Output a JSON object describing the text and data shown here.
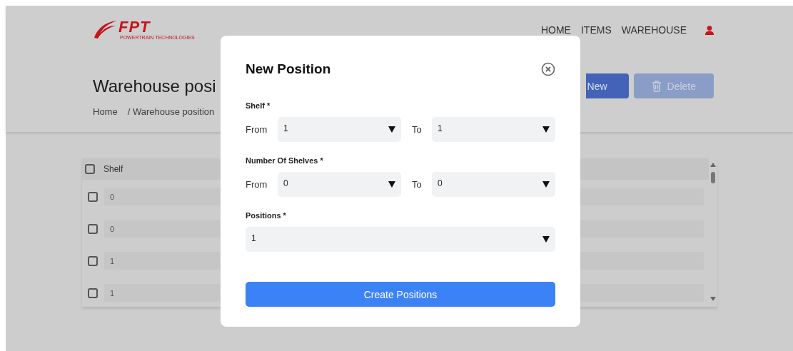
{
  "header": {
    "logo": {
      "brand": "FPT",
      "tagline": "POWERTRAIN TECHNOLOGIES"
    },
    "nav": [
      {
        "label": "HOME"
      },
      {
        "label": "ITEMS"
      },
      {
        "label": "WAREHOUSE"
      }
    ]
  },
  "page": {
    "title": "Warehouse posi",
    "breadcrumb": [
      {
        "label": "Home"
      },
      {
        "label": "/ Warehouse position"
      }
    ],
    "actions": [
      {
        "label": "New",
        "kind": "primary",
        "disabled": false
      },
      {
        "label": "Delete",
        "kind": "delete",
        "disabled": true
      }
    ]
  },
  "table": {
    "header": {
      "label": "Shelf",
      "checked": false
    },
    "rows": [
      {
        "shelf": "0",
        "checked": false
      },
      {
        "shelf": "0",
        "checked": false
      },
      {
        "shelf": "1",
        "checked": false
      },
      {
        "shelf": "1",
        "checked": false
      }
    ]
  },
  "modal": {
    "title": "New Position",
    "fields": [
      {
        "kind": "range",
        "label": "Shelf *",
        "from_label": "From",
        "from_value": "1",
        "to_label": "To",
        "to_value": "1"
      },
      {
        "kind": "range",
        "label": "Number Of Shelves *",
        "from_label": "From",
        "from_value": "0",
        "to_label": "To",
        "to_value": "0"
      },
      {
        "kind": "single",
        "label": "Positions *",
        "value": "1"
      }
    ],
    "submit": "Create Positions"
  }
}
